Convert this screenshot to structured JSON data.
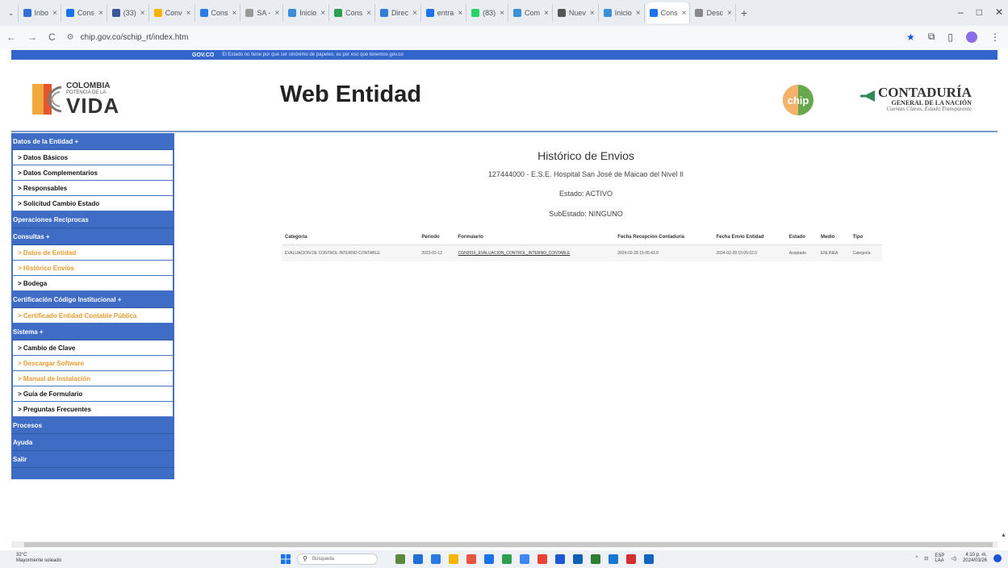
{
  "browser": {
    "tabs": [
      {
        "label": "Inbo",
        "color": "#2f6fd6"
      },
      {
        "label": "Cons",
        "color": "#1a73e8"
      },
      {
        "label": "(33)",
        "color": "#3b5998"
      },
      {
        "label": "Conv",
        "color": "#f4b400"
      },
      {
        "label": "Cons",
        "color": "#2a7be4"
      },
      {
        "label": "SA -",
        "color": "#999999"
      },
      {
        "label": "Inicio",
        "color": "#3a8fd9"
      },
      {
        "label": "Cons",
        "color": "#2d9d4f"
      },
      {
        "label": "Direc",
        "color": "#2f7fd6"
      },
      {
        "label": "entra",
        "color": "#1a73e8"
      },
      {
        "label": "(83)",
        "color": "#25d366"
      },
      {
        "label": "Com",
        "color": "#3a8fd9"
      },
      {
        "label": "Nuev",
        "color": "#555555"
      },
      {
        "label": "Inicio",
        "color": "#3a8fd9"
      },
      {
        "label": "Cons",
        "color": "#1a73e8",
        "active": true
      },
      {
        "label": "Desc",
        "color": "#888888"
      }
    ],
    "new_tab": "+",
    "url": "chip.gov.co/schip_rt/index.htm",
    "win_controls": [
      "–",
      "□",
      "✕"
    ]
  },
  "govbar": {
    "govco": "GOV.CO",
    "text": "El Estado no tiene por qué ser sinónimo de papeleo, es por eso que tenemos gov.co"
  },
  "header": {
    "logo_line1": "COLOMBIA",
    "logo_line2": "POTENCIA DE LA",
    "logo_line3": "VIDA",
    "title": "Web Entidad",
    "cgn_line1": "CONTADURÍA",
    "cgn_line2": "GENERAL DE LA NACIÓN",
    "cgn_line3": "Cuentas Claras, Estado Transparente",
    "chip_label": "chip"
  },
  "sidebar": [
    {
      "type": "head",
      "label": "Datos de la Entidad +"
    },
    {
      "type": "item",
      "label": "> Datos Básicos"
    },
    {
      "type": "item",
      "label": "> Datos Complementarios"
    },
    {
      "type": "item",
      "label": "> Responsables"
    },
    {
      "type": "item",
      "label": "> Solicitud Cambio Estado"
    },
    {
      "type": "head",
      "label": "Operaciones Recíprocas"
    },
    {
      "type": "head",
      "label": "Consultas +"
    },
    {
      "type": "item",
      "label": "> Datos de Entidad",
      "accent": true
    },
    {
      "type": "item",
      "label": "> Histórico Envíos",
      "accent": true
    },
    {
      "type": "item",
      "label": "> Bodega"
    },
    {
      "type": "head",
      "label": "Certificación Código Institucional +"
    },
    {
      "type": "item",
      "label": "> Certificado Entidad Contable Pública",
      "accent": true
    },
    {
      "type": "head",
      "label": "Sistema +"
    },
    {
      "type": "item",
      "label": "> Cambio de Clave"
    },
    {
      "type": "item",
      "label": "> Descargar Software",
      "accent": true
    },
    {
      "type": "item",
      "label": "> Manual de Instalación",
      "accent": true
    },
    {
      "type": "item",
      "label": "> Guía de Formulario"
    },
    {
      "type": "item",
      "label": "> Preguntas Frecuentes"
    },
    {
      "type": "head",
      "label": "Procesos"
    },
    {
      "type": "head",
      "label": "Ayuda"
    },
    {
      "type": "head",
      "label": "Salir"
    }
  ],
  "main": {
    "title": "Histórico de Envios",
    "entity": "127444000 - E.S.E. Hospital San José de Maicao del Nivel II",
    "estado": "Estado: ACTIVO",
    "subestado": "SubEstado: NINGUNO",
    "table": {
      "headers": [
        "Categoría",
        "Periodo",
        "Formulario",
        "Fecha Recepción Contaduría",
        "Fecha Envío Entidad",
        "Estado",
        "Medio",
        "Tipo"
      ],
      "rows": [
        [
          "EVALUACION DE CONTROL INTERNO CONTABLE",
          "2023-01-12",
          "CGN2016_EVALUACION_CONTROL_INTERNO_CONTABLE",
          "2024-02-28 15:05:43.0",
          "2024-02-28 15:05:02.0",
          "Aceptado",
          "ENLINEA",
          "Categoría"
        ]
      ]
    }
  },
  "taskbar": {
    "weather_temp": "32°C",
    "weather_desc": "Mayormente soleado",
    "search_placeholder": "Búsqueda",
    "apps": [
      "#5a8a3a",
      "#1f6fd6",
      "#2a7be4",
      "#f4b400",
      "#e8553e",
      "#1a73e8",
      "#2d9d4f",
      "#4285f4",
      "#ea4335",
      "#1a56d6",
      "#0f5fb6",
      "#2e7d32",
      "#1976d2",
      "#d32f2f",
      "#1565c0"
    ],
    "lang1": "ESP",
    "lang2": "LAA",
    "time": "4:10 p. m.",
    "date": "2024/03/26"
  }
}
